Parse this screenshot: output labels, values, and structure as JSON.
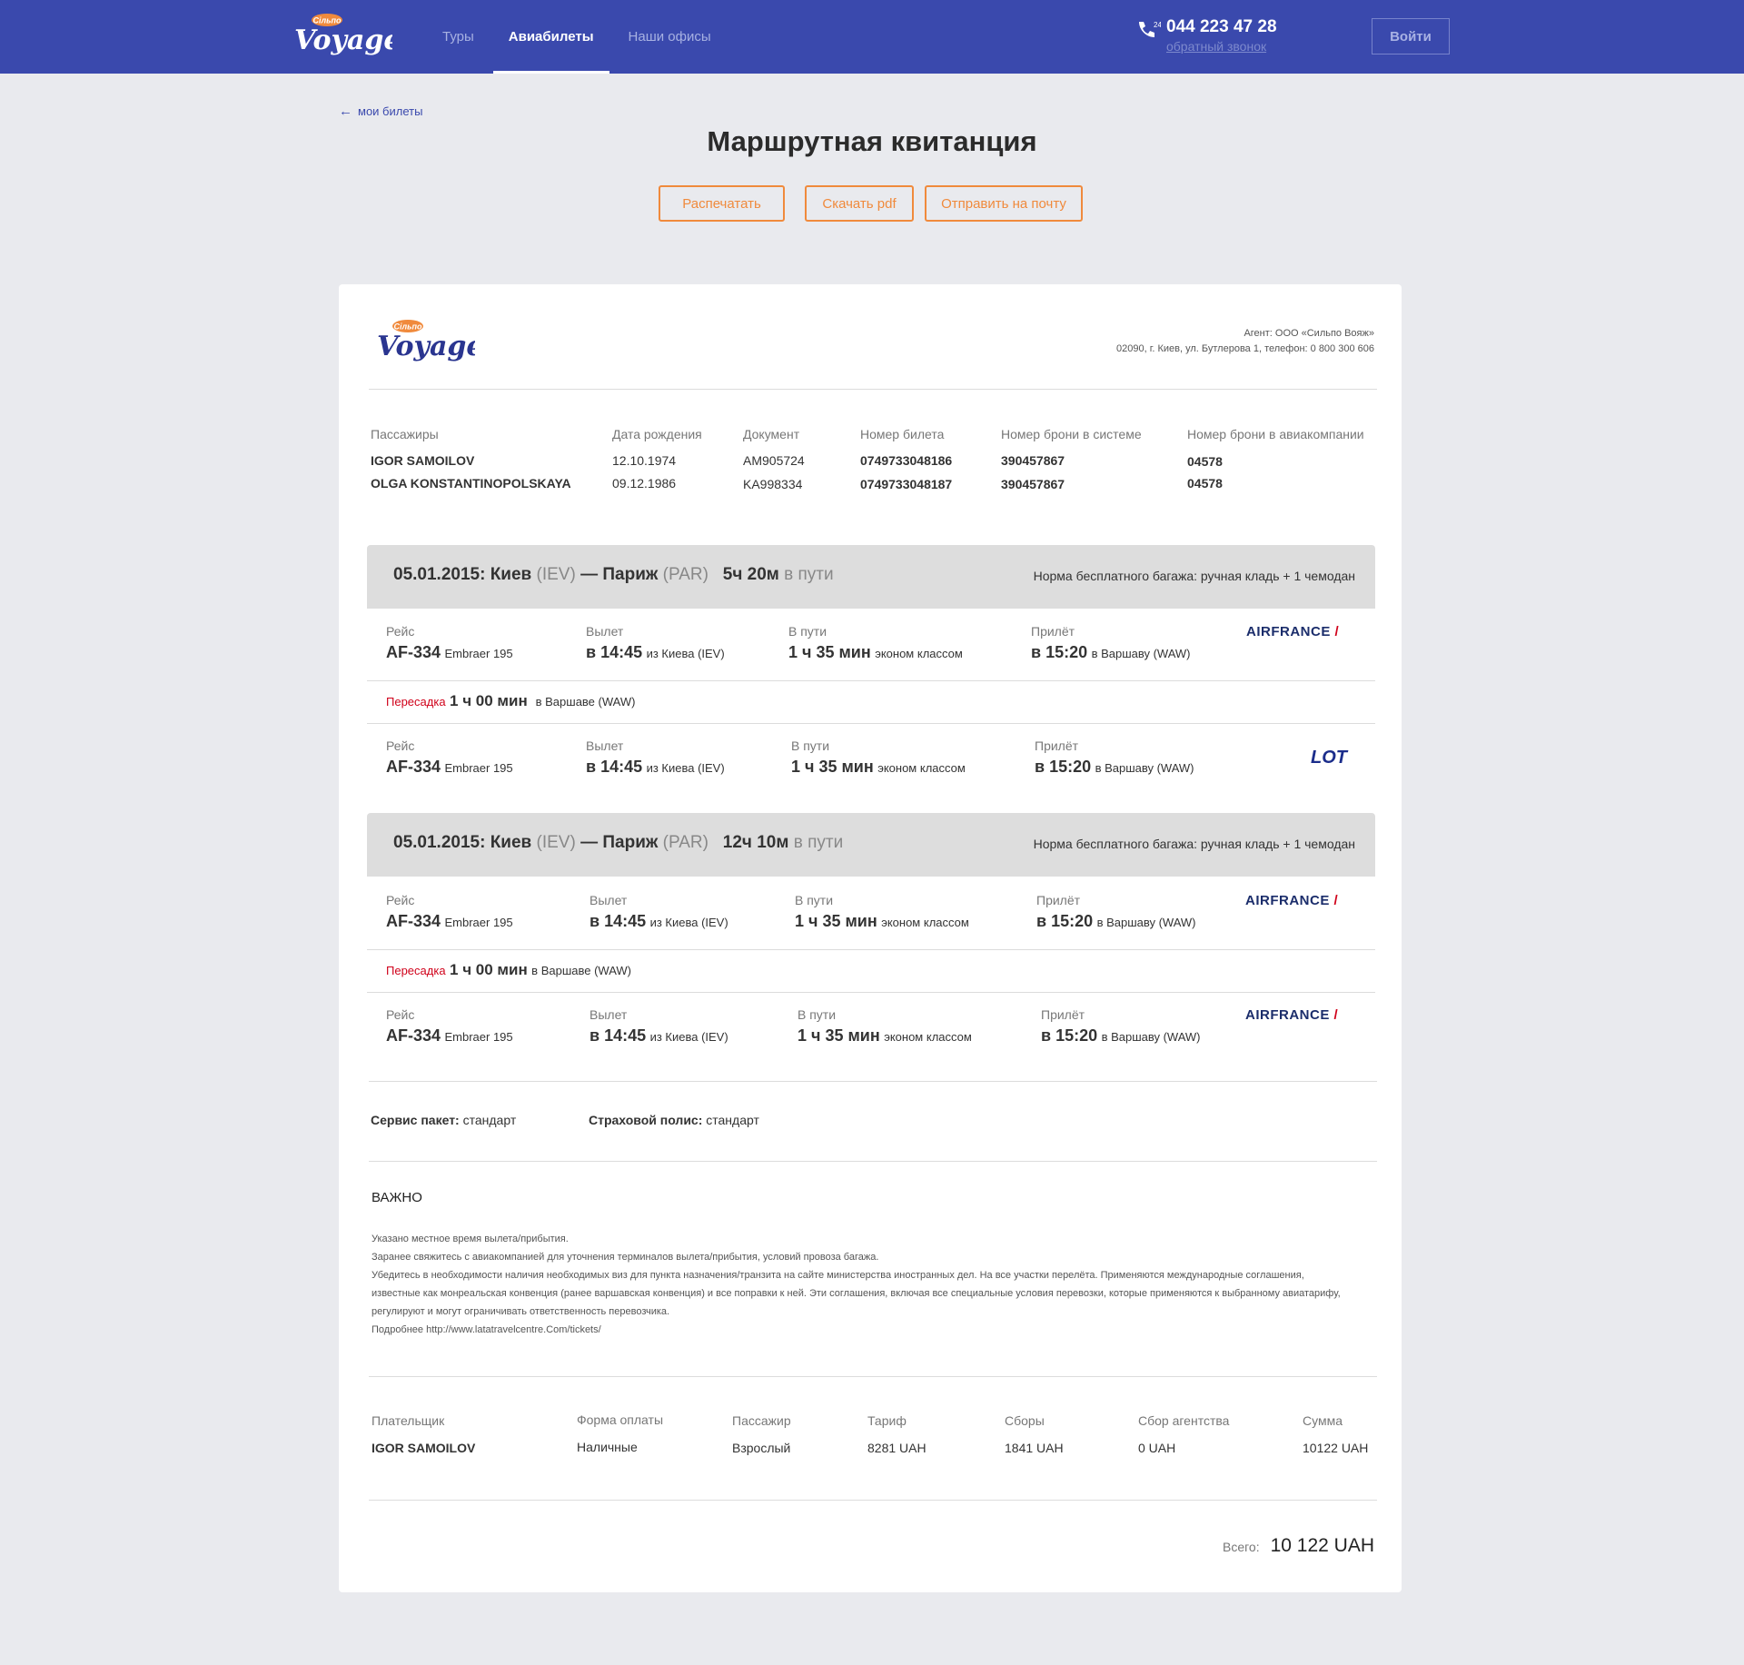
{
  "header": {
    "logo_text": "Voyage",
    "logo_small": "Сільпо",
    "nav": [
      "Туры",
      "Авиабилеты",
      "Наши офисы"
    ],
    "active_nav": "Авиабилеты",
    "phone_icon": "phone-24-icon",
    "phone_badge": "24",
    "phone": "044 223 47 28",
    "callback": "обратный звонок",
    "login": "Войти",
    "bg_color": "#3a49ad"
  },
  "back_link": "мои билеты",
  "page_title": "Маршрутная квитанция",
  "actions": {
    "print": "Распечатать",
    "pdf": "Скачать pdf",
    "email": "Отправить на почту",
    "accent_color": "#f08a3c"
  },
  "agent": {
    "line1": "Агент: ООО «Сильпо Вояж»",
    "line2": "02090, г. Киев, ул. Бутлерова 1, телефон: 0 800 300 606"
  },
  "passengers": {
    "headers": [
      "Пассажиры",
      "Дата рождения",
      "Документ",
      "Номер билета",
      "Номер брони в системе",
      "Номер брони в авиакомпании"
    ],
    "rows": [
      [
        "IGOR SAMOILOV",
        "12.10.1974",
        "AM905724",
        "0749733048186",
        "390457867",
        "04578"
      ],
      [
        "OLGA KONSTANTINOPOLSKAYA",
        "09.12.1986",
        "KA998334",
        "0749733048187",
        "390457867",
        "04578"
      ]
    ]
  },
  "segments": [
    {
      "date_from": "05.01.2015: Киев",
      "from_code": "(IEV)",
      "sep": "—",
      "to": "Париж",
      "to_code": "(PAR)",
      "duration": "5ч 20м",
      "duration_suffix": "в пути",
      "baggage": "Норма бесплатного багажа: ручная кладь + 1 чемодан",
      "flights": [
        {
          "flight_label": "Рейс",
          "flight": "AF-334",
          "aircraft": "Embraer 195",
          "dep_label": "Вылет",
          "dep_time": "в 14:45",
          "dep_from": "из Киева (IEV)",
          "dur_label": "В пути",
          "dur": "1 ч 35 мин",
          "class": "эконом классом",
          "arr_label": "Прилёт",
          "arr_time": "в 15:20",
          "arr_to": "в Варшаву (WAW)",
          "airline": "AIRFRANCE",
          "airline_type": "airfrance"
        },
        {
          "flight_label": "Рейс",
          "flight": "AF-334",
          "aircraft": "Embraer 195",
          "dep_label": "Вылет",
          "dep_time": "в 14:45",
          "dep_from": "из Киева (IEV)",
          "dur_label": "В пути",
          "dur": "1 ч 35 мин",
          "class": "эконом классом",
          "arr_label": "Прилёт",
          "arr_time": "в 15:20",
          "arr_to": "в Варшаву (WAW)",
          "airline": "LOT",
          "airline_type": "lot"
        }
      ],
      "transfer": {
        "label": "Пересадка",
        "time": "1 ч 00 мин",
        "place": "в Варшаве (WAW)"
      }
    },
    {
      "date_from": "05.01.2015: Киев",
      "from_code": "(IEV)",
      "sep": "—",
      "to": "Париж",
      "to_code": "(PAR)",
      "duration": "12ч 10м",
      "duration_suffix": "в пути",
      "baggage": "Норма бесплатного багажа: ручная кладь + 1 чемодан",
      "flights": [
        {
          "flight_label": "Рейс",
          "flight": "AF-334",
          "aircraft": "Embraer 195",
          "dep_label": "Вылет",
          "dep_time": "в 14:45",
          "dep_from": "из Киева (IEV)",
          "dur_label": "В пути",
          "dur": "1 ч 35 мин",
          "class": "эконом классом",
          "arr_label": "Прилёт",
          "arr_time": "в 15:20",
          "arr_to": "в Варшаву (WAW)",
          "airline": "AIRFRANCE",
          "airline_type": "airfrance"
        },
        {
          "flight_label": "Рейс",
          "flight": "AF-334",
          "aircraft": "Embraer 195",
          "dep_label": "Вылет",
          "dep_time": "в 14:45",
          "dep_from": "из Киева (IEV)",
          "dur_label": "В пути",
          "dur": "1 ч 35 мин",
          "class": "эконом классом",
          "arr_label": "Прилёт",
          "arr_time": "в 15:20",
          "arr_to": "в Варшаву (WAW)",
          "airline": "AIRFRANCE",
          "airline_type": "airfrance"
        }
      ],
      "transfer": {
        "label": "Пересадка",
        "time": "1 ч 00 мин",
        "place": "в Варшаве (WAW)"
      }
    }
  ],
  "services": {
    "package_label": "Сервис пакет:",
    "package_value": "стандарт",
    "insurance_label": "Страховой полис:",
    "insurance_value": "стандарт"
  },
  "important": {
    "title": "ВАЖНО",
    "lines": [
      "Указано местное время вылета/прибытия.",
      "Заранее свяжитесь с авиакомпанией для уточнения терминалов вылета/прибытия, условий провоза багажа.",
      "Убедитесь в необходимости наличия необходимых виз для пункта назначения/транзита на сайте министерства иностранных дел. На все участки перелёта. Применяются международные соглашения, известные как монреальская конвенция (ранее варшавская конвенция) и все поправки к ней. Эти соглашения, включая все специальные условия перевозки, которые применяются к выбранному авиатарифу, регулируют и могут ограничивать ответственность перевозчика.",
      "Подробнее http://www.latatravelcentre.Com/tickets/"
    ]
  },
  "payment": {
    "headers": [
      "Плательщик",
      "Форма оплаты",
      "Пассажир",
      "Тариф",
      "Сборы",
      "Сбор агентства",
      "Сумма"
    ],
    "row": [
      "IGOR SAMOILOV",
      "Наличные",
      "Взрослый",
      "8281 UAH",
      "1841 UAH",
      "0 UAH",
      "10122 UAH"
    ]
  },
  "total": {
    "label": "Всего:",
    "value": "10 122 UAH"
  }
}
